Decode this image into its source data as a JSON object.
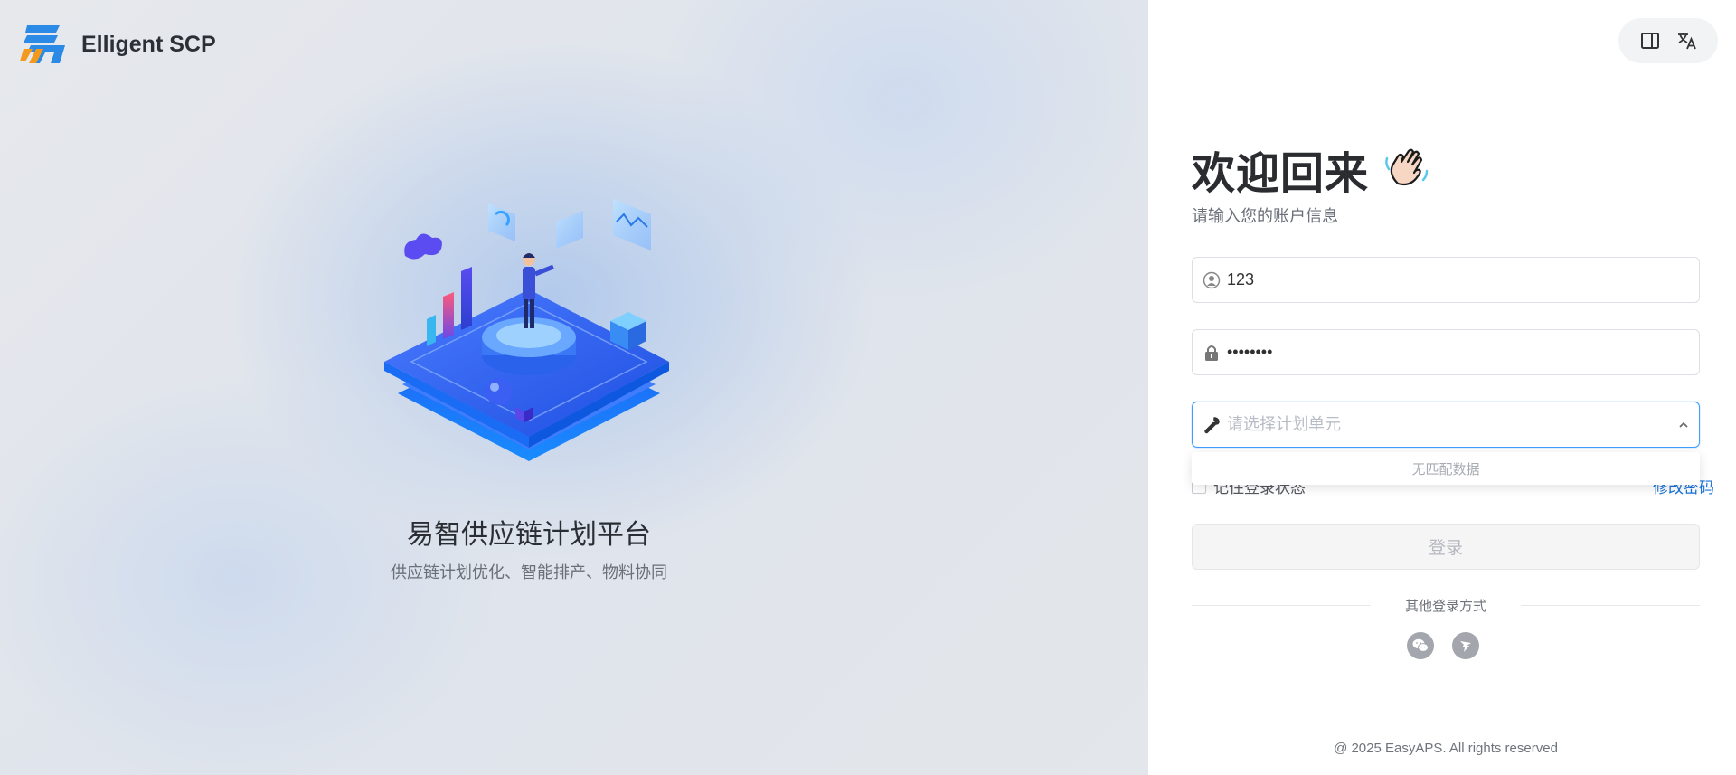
{
  "brand": {
    "name": "Elligent SCP",
    "logo_icon": "easy-logo-icon"
  },
  "hero": {
    "title": "易智供应链计划平台",
    "subtitle": "供应链计划优化、智能排产、物料协同",
    "illustration_icon": "isometric-data-platform-illustration"
  },
  "toolbar": {
    "layout_icon": "sidebar-layout-icon",
    "language_icon": "translate-icon"
  },
  "login": {
    "title": "欢迎回来",
    "wave_icon": "waving-hand-icon",
    "subtitle": "请输入您的账户信息",
    "username": {
      "value": "123",
      "icon": "user-icon"
    },
    "password": {
      "value": "••••••••",
      "icon": "lock-icon"
    },
    "unit": {
      "placeholder": "请选择计划单元",
      "icon": "wrench-icon",
      "dropdown_empty": "无匹配数据"
    },
    "remember_label": "记住登录状态",
    "forgot_label": "修改密码",
    "submit_label": "登录",
    "other_methods_label": "其他登录方式",
    "social": [
      {
        "icon": "wechat-icon"
      },
      {
        "icon": "dingtalk-icon"
      }
    ]
  },
  "footer": {
    "copyright": "@ 2025 EasyAPS. All rights reserved"
  },
  "colors": {
    "accent": "#409eff",
    "link": "#1a73d9",
    "brand_blue": "#2a8ae6",
    "brand_orange": "#f39a1e"
  }
}
